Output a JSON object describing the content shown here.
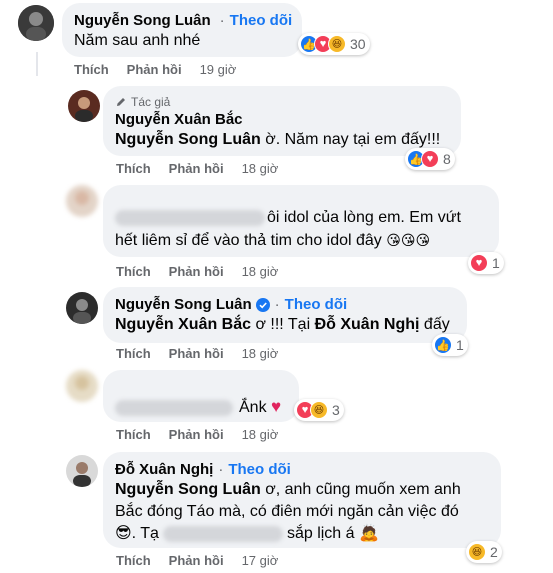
{
  "comments": [
    {
      "name": "Nguyễn Song Luân",
      "follow": "Theo dõi",
      "text": "Năm sau anh nhé",
      "reactions": "30",
      "like": "Thích",
      "reply": "Phản hồi",
      "time": "19 giờ"
    },
    {
      "author_tag": "Tác giả",
      "name": "Nguyễn Xuân Bắc",
      "mention": "Nguyễn Song Luân",
      "text": " ờ. Năm nay tại em đấy!!!",
      "reactions": "8",
      "like": "Thích",
      "reply": "Phản hồi",
      "time": "18 giờ"
    },
    {
      "text_line1": "ôi idol của lòng em. Em vứt",
      "text_line2": "hết liêm sỉ để vào thả tim cho idol đây",
      "emojis": "😘😘😘",
      "reactions": "1",
      "like": "Thích",
      "reply": "Phản hồi",
      "time": "18 giờ"
    },
    {
      "name": "Nguyễn Song Luân",
      "follow": "Theo dõi",
      "mention": "Nguyễn Xuân Bắc",
      "text_mid": " ơ !!! Tại ",
      "mention2": "Đỗ Xuân Nghị",
      "text_end": " đấy",
      "reactions": "1",
      "like": "Thích",
      "reply": "Phản hồi",
      "time": "18 giờ"
    },
    {
      "text": "Ắnk",
      "emoji": "♥",
      "reactions": "3",
      "like": "Thích",
      "reply": "Phản hồi",
      "time": "18 giờ"
    },
    {
      "name": "Đỗ Xuân Nghị",
      "follow": "Theo dõi",
      "mention": "Nguyễn Song Luân",
      "text_line1": " ơ, anh cũng muốn xem anh",
      "text_line2": "Bắc đóng Táo mà, có điên mới ngăn cản việc đó",
      "text_line3_a": "😎. Tạ",
      "text_line3_b": "sắp lịch á",
      "emoji_end": "🙇",
      "reactions": "2",
      "like": "Thích",
      "reply": "Phản hồi",
      "time": "17 giờ"
    }
  ],
  "colors": {
    "bubble": "#f0f2f5",
    "accent": "#1877f2",
    "meta": "#65676b",
    "love": "#f33e58",
    "haha": "#f7b928"
  }
}
